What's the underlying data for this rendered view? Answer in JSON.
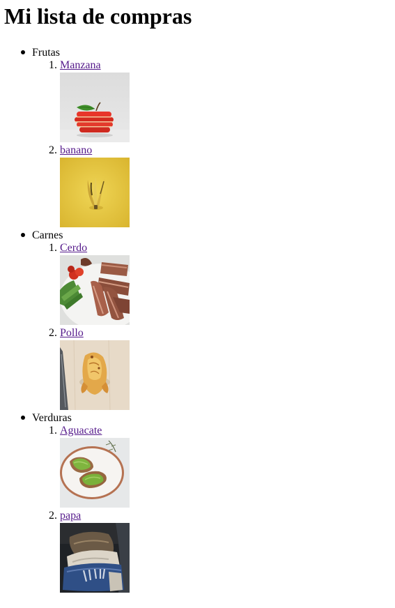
{
  "page": {
    "title": "Mi lista de compras"
  },
  "colors": {
    "link_visited": "#551a8b",
    "text": "#000000",
    "background": "#ffffff"
  },
  "categories": [
    {
      "label": "Frutas",
      "items": [
        {
          "number": "1.",
          "label": "Manzana",
          "image": "sliced-apple-photo"
        },
        {
          "number": "2.",
          "label": "banano",
          "image": "banana-peel-photo"
        }
      ]
    },
    {
      "label": "Carnes",
      "items": [
        {
          "number": "1.",
          "label": "Cerdo",
          "image": "pork-steak-plate-photo"
        },
        {
          "number": "2.",
          "label": "Pollo",
          "image": "roast-chicken-photo"
        }
      ]
    },
    {
      "label": "Verduras",
      "items": [
        {
          "number": "1.",
          "label": "Aguacate",
          "image": "avocado-toast-photo"
        },
        {
          "number": "2.",
          "label": "papa",
          "image": "potato-sack-photo"
        }
      ]
    }
  ]
}
